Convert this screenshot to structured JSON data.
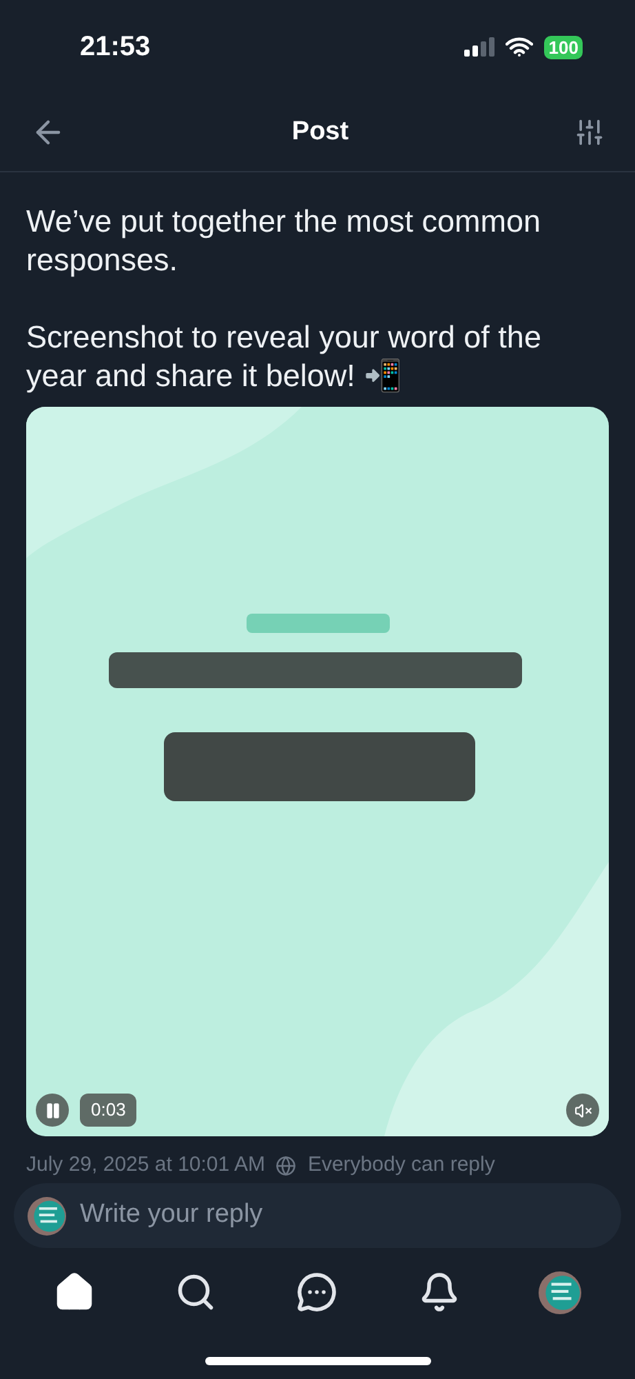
{
  "status_bar": {
    "time": "21:53",
    "battery": "100"
  },
  "header": {
    "title": "Post"
  },
  "post": {
    "paragraphs": [
      "We’ve put together the most common responses.",
      "Screenshot to reveal your word of the year and share it below! 📲"
    ],
    "video": {
      "kind": "picture",
      "playing": true,
      "time": "0:03",
      "muted": true
    },
    "meta": {
      "date": "July 29, 2025 at 10:01 AM",
      "reply_setting": "Everybody can reply"
    }
  },
  "reply": {
    "placeholder": "Write your reply"
  },
  "nav": [
    {
      "kind": "home",
      "selected": true
    },
    {
      "kind": "search",
      "selected": false
    },
    {
      "kind": "messages",
      "selected": false
    },
    {
      "kind": "notifications",
      "selected": false
    },
    {
      "kind": "profile",
      "selected": false
    }
  ]
}
